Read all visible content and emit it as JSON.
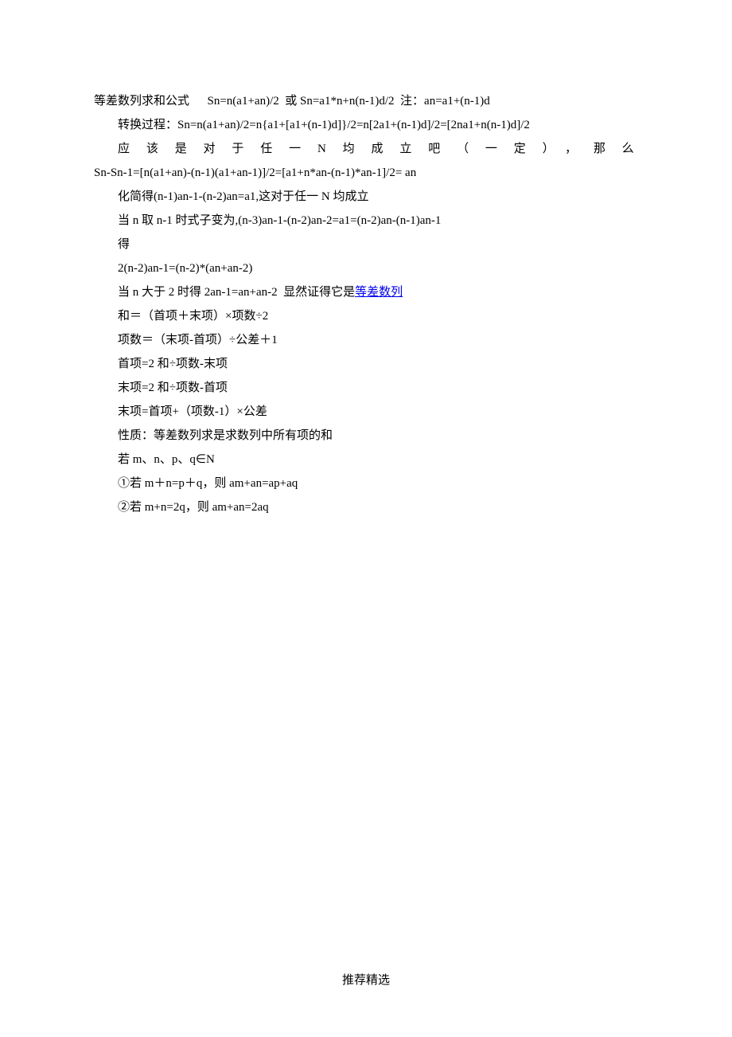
{
  "lines": {
    "l1": "等差数列求和公式      Sn=n(a1+an)/2  或 Sn=a1*n+n(n-1)d/2  注：an=a1+(n-1)d",
    "l2": "转换过程：Sn=n(a1+an)/2=n{a1+[a1+(n-1)d]}/2=n[2a1+(n-1)d]/2=[2na1+n(n-1)d]/2",
    "l3": "应该是对于任一N均成立吧（一定），那么",
    "l4": "Sn-Sn-1=[n(a1+an)-(n-1)(a1+an-1)]/2=[a1+n*an-(n-1)*an-1]/2= an",
    "l5": "化简得(n-1)an-1-(n-2)an=a1,这对于任一 N 均成立",
    "l6": "当 n 取 n-1 时式子变为,(n-3)an-1-(n-2)an-2=a1=(n-2)an-(n-1)an-1",
    "l7": "得",
    "l8": "2(n-2)an-1=(n-2)*(an+an-2)",
    "l9a": "当 n 大于 2 时得 2an-1=an+an-2  显然证得它是",
    "l9link": "等差数列",
    "l10": "和＝（首项＋末项）×项数÷2",
    "l11": "项数＝（末项-首项）÷公差＋1",
    "l12": "首项=2 和÷项数-末项",
    "l13": "末项=2 和÷项数-首项",
    "l14": "末项=首项+（项数-1）×公差",
    "l15": "性质：等差数列求是求数列中所有项的和",
    "l16": "若 m、n、p、q∈N",
    "l17": "①若 m＋n=p＋q，则 am+an=ap+aq",
    "l18": "②若 m+n=2q，则 am+an=2aq"
  },
  "footer": "推荐精选"
}
